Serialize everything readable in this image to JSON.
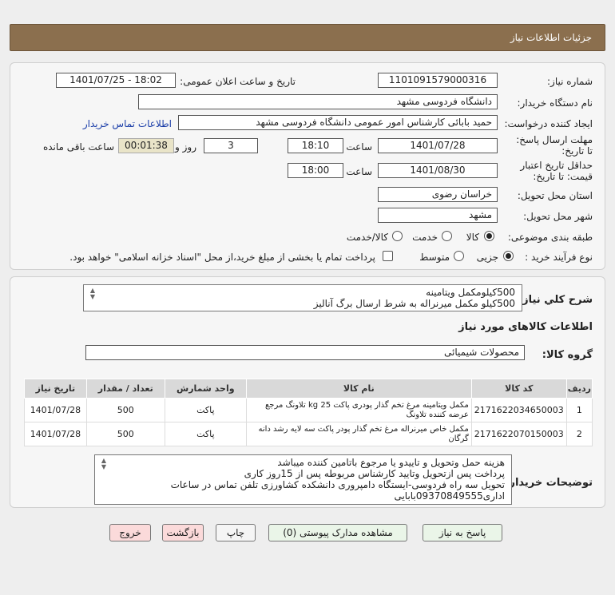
{
  "header": {
    "title": "جزئیات اطلاعات نیاز"
  },
  "form": {
    "need_number_label": "شماره نیاز:",
    "need_number": "1101091579000316",
    "announce_label": "تاریخ و ساعت اعلان عمومی:",
    "announce_value": "1401/07/25 - 18:02",
    "buyer_org_label": "نام دستگاه خریدار:",
    "buyer_org": "دانشگاه فردوسی مشهد",
    "requester_label": "ایجاد کننده درخواست:",
    "requester": "حمید بابائی کارشناس امور عمومی دانشگاه فردوسی مشهد",
    "contact_link": "اطلاعات تماس خریدار",
    "deadline_label": "مهلت ارسال پاسخ: تا تاریخ:",
    "deadline_date": "1401/07/28",
    "time_label": "ساعت",
    "deadline_time": "18:10",
    "days_value": "3",
    "days_label": "روز و",
    "remaining_time": "00:01:38",
    "remaining_label": "ساعت باقی مانده",
    "validity_label": "حداقل تاریخ اعتبار قیمت: تا تاریخ:",
    "validity_date": "1401/08/30",
    "validity_time": "18:00",
    "province_label": "استان محل تحویل:",
    "province": "خراسان رضوی",
    "city_label": "شهر محل تحویل:",
    "city": "مشهد",
    "category_label": "طبقه بندی موضوعی:",
    "category_options": [
      "کالا",
      "خدمت",
      "کالا/خدمت"
    ],
    "process_label": "نوع فرآیند خرید :",
    "process_options": [
      "جزیی",
      "متوسط"
    ],
    "payment_note": "پرداخت تمام یا بخشی از مبلغ خرید،از محل \"اسناد خزانه اسلامی\" خواهد بود."
  },
  "summary": {
    "label": "شرح کلي نياز:",
    "line1": "500کیلومکمل ویتامینه",
    "line2": "500کیلو مکمل میرنراله به شرط ارسال برگ آنالیز"
  },
  "goods": {
    "section_title": "اطلاعات کالاهای مورد نیاز",
    "group_label": "گروه کالا:",
    "group_value": "محصولات شیمیائی",
    "columns": [
      "ردیف",
      "کد کالا",
      "نام کالا",
      "واحد شمارش",
      "تعداد / مقدار",
      "تاریخ نیاز"
    ],
    "rows": [
      {
        "idx": "1",
        "code": "2171622034650003",
        "name": "مکمل ویتامینه مرغ تخم گذار پودری پاکت 25 kg تلاونگ مرجع عرضه کننده تلاونگ",
        "unit": "پاکت",
        "qty": "500",
        "date": "1401/07/28"
      },
      {
        "idx": "2",
        "code": "2171622070150003",
        "name": "مکمل خاص میرنراله مرغ تخم گذار پودر پاکت سه لایه رشد دانه گرگان",
        "unit": "پاکت",
        "qty": "500",
        "date": "1401/07/28"
      }
    ]
  },
  "buyer_notes": {
    "label": "توضیحات خریدار:",
    "line1": "هزینه حمل وتحویل و تاییدو یا مرجوع باتامین کننده میباشد",
    "line2": "پرداخت پس ازتحویل وتایید کارشناس مربوطه پس از 15روز کاری",
    "line3": "تحویل سه راه فردوسی-ایستگاه دامپروری دانشکده کشاورزی تلفن تماس در ساعات",
    "line4": "اداری09370849555بابایی"
  },
  "buttons": {
    "reply": "پاسخ به نیاز",
    "attachments": "مشاهده مدارک پیوستی (0)",
    "print": "چاپ",
    "back": "بازگشت",
    "exit": "خروج"
  },
  "colors": {
    "header": "#8b6f4e",
    "link": "#1a3da8",
    "timer_bg": "#e9e4c8"
  }
}
